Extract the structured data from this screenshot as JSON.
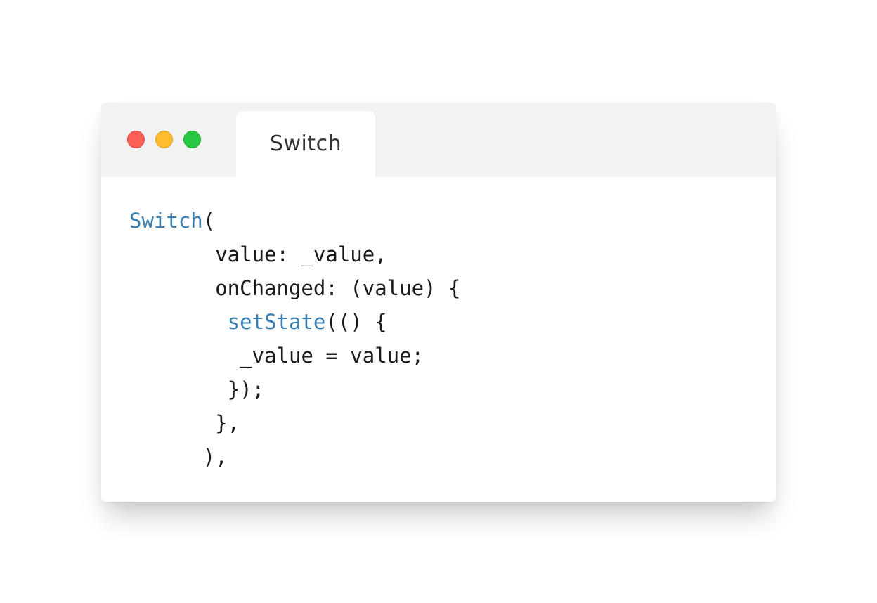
{
  "window": {
    "controls": [
      {
        "name": "close",
        "color": "#fe5f57"
      },
      {
        "name": "minimize",
        "color": "#febc2e"
      },
      {
        "name": "maximize",
        "color": "#28c840"
      }
    ],
    "tab": {
      "label": "Switch"
    }
  },
  "code": {
    "accent_color": "#3a7fb0",
    "lines": [
      {
        "indent": 0,
        "tokens": [
          {
            "text": "Switch",
            "kind": "keyword"
          },
          {
            "text": "(",
            "kind": "plain"
          }
        ]
      },
      {
        "indent": 7,
        "tokens": [
          {
            "text": "value: _value,",
            "kind": "plain"
          }
        ]
      },
      {
        "indent": 7,
        "tokens": [
          {
            "text": "onChanged: (value) {",
            "kind": "plain"
          }
        ]
      },
      {
        "indent": 8,
        "tokens": [
          {
            "text": "setState",
            "kind": "keyword"
          },
          {
            "text": "(() {",
            "kind": "plain"
          }
        ]
      },
      {
        "indent": 9,
        "tokens": [
          {
            "text": "_value = value;",
            "kind": "plain"
          }
        ]
      },
      {
        "indent": 8,
        "tokens": [
          {
            "text": "});",
            "kind": "plain"
          }
        ]
      },
      {
        "indent": 7,
        "tokens": [
          {
            "text": "},",
            "kind": "plain"
          }
        ]
      },
      {
        "indent": 6,
        "tokens": [
          {
            "text": "),",
            "kind": "plain"
          }
        ]
      }
    ]
  }
}
